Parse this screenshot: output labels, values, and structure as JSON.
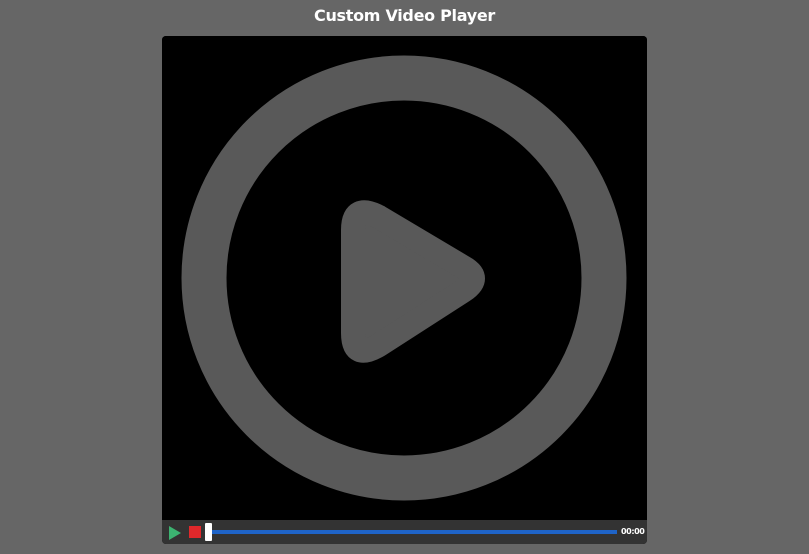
{
  "page": {
    "title": "Custom Video Player"
  },
  "player": {
    "big_play_icon": "play-circle-icon",
    "controls": {
      "play_icon": "play-icon",
      "stop_icon": "stop-icon",
      "progress": 0,
      "time": "00:00"
    }
  },
  "colors": {
    "background": "#666666",
    "video": "#000000",
    "overlay_icon": "#595959",
    "controls_bar": "#333333",
    "play_button": "#3cb371",
    "stop_button": "#e0282b",
    "progress_track": "#1f64c8",
    "scrubber": "#ffffff",
    "text": "#ffffff"
  }
}
